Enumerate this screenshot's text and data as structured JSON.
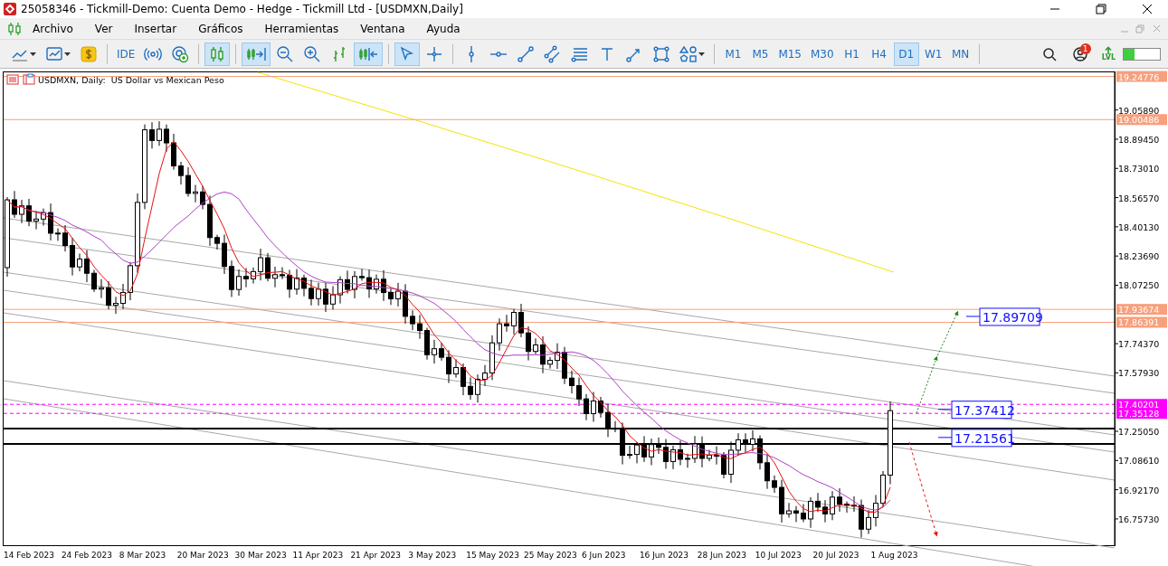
{
  "window": {
    "title": "25058346 - Tickmill-Demo: Cuenta Demo - Hedge - Tickmill Ltd - [USDMXN,Daily]"
  },
  "menu": {
    "items": [
      "Archivo",
      "Ver",
      "Insertar",
      "Gráficos",
      "Herramientas",
      "Ventana",
      "Ayuda"
    ]
  },
  "toolbar": {
    "tools": [
      {
        "kind": "linechart",
        "selected": false
      },
      {
        "kind": "chartset",
        "selected": false
      },
      {
        "kind": "dollar",
        "selected": false
      },
      {
        "kind": "ide",
        "label": "IDE",
        "selected": false
      },
      {
        "kind": "signal",
        "selected": false
      },
      {
        "kind": "market",
        "selected": false
      },
      {
        "kind": "candles",
        "selected": true
      },
      {
        "kind": "autoscroll",
        "selected": true
      },
      {
        "kind": "zoomout",
        "selected": false
      },
      {
        "kind": "zoomin",
        "selected": false
      },
      {
        "kind": "bars",
        "selected": false
      },
      {
        "kind": "shift",
        "selected": true
      },
      {
        "kind": "cursor",
        "selected": true
      },
      {
        "kind": "crosshair",
        "selected": false
      },
      {
        "kind": "vline",
        "selected": false
      },
      {
        "kind": "hline",
        "selected": false
      },
      {
        "kind": "trend",
        "selected": false
      },
      {
        "kind": "channel",
        "selected": false
      },
      {
        "kind": "fibo",
        "selected": false
      },
      {
        "kind": "text",
        "selected": false
      },
      {
        "kind": "arrow",
        "selected": false
      },
      {
        "kind": "rect",
        "selected": false
      },
      {
        "kind": "shapes",
        "selected": false
      }
    ],
    "timeframes": [
      {
        "label": "M1",
        "selected": false
      },
      {
        "label": "M5",
        "selected": false
      },
      {
        "label": "M15",
        "selected": false
      },
      {
        "label": "M30",
        "selected": false
      },
      {
        "label": "H1",
        "selected": false
      },
      {
        "label": "H4",
        "selected": false
      },
      {
        "label": "D1",
        "selected": true
      },
      {
        "label": "W1",
        "selected": false
      },
      {
        "label": "MN",
        "selected": false
      }
    ],
    "notification_count": "1",
    "lvl_label": "LVL",
    "meter": {
      "level": 0.3
    }
  },
  "chart": {
    "title": "USDMXN, Daily:  US Dollar vs Mexican Peso",
    "price_ticks": [
      "19.05890",
      "18.89450",
      "18.73010",
      "18.56570",
      "18.40130",
      "18.23690",
      "18.07250",
      "17.74370",
      "17.57930",
      "17.25050",
      "17.08610",
      "16.92170",
      "16.75730"
    ],
    "price_tags": [
      {
        "label": "19.24776",
        "color": "#f7a07e",
        "kind": "solid"
      },
      {
        "label": "19.00486",
        "color": "#f7a07e",
        "kind": "solid"
      },
      {
        "label": "17.93674",
        "color": "#f7a07e",
        "kind": "solid"
      },
      {
        "label": "17.86391",
        "color": "#f7a07e",
        "kind": "solid"
      },
      {
        "label": "17.40201",
        "color": "#ff00ff",
        "kind": "dashed"
      },
      {
        "label": "17.35128",
        "color": "#ff00ff",
        "kind": "dashed"
      }
    ],
    "level_boxes": [
      "17.89709",
      "17.37412",
      "17.21561"
    ],
    "date_labels": [
      "14 Feb 2023",
      "24 Feb 2023",
      "8 Mar 2023",
      "20 Mar 2023",
      "30 Mar 2023",
      "11 Apr 2023",
      "21 Apr 2023",
      "3 May 2023",
      "15 May 2023",
      "25 May 2023",
      "6 Jun 2023",
      "16 Jun 2023",
      "28 Jun 2023",
      "10 Jul 2023",
      "20 Jul 2023",
      "1 Aug 2023"
    ]
  }
}
